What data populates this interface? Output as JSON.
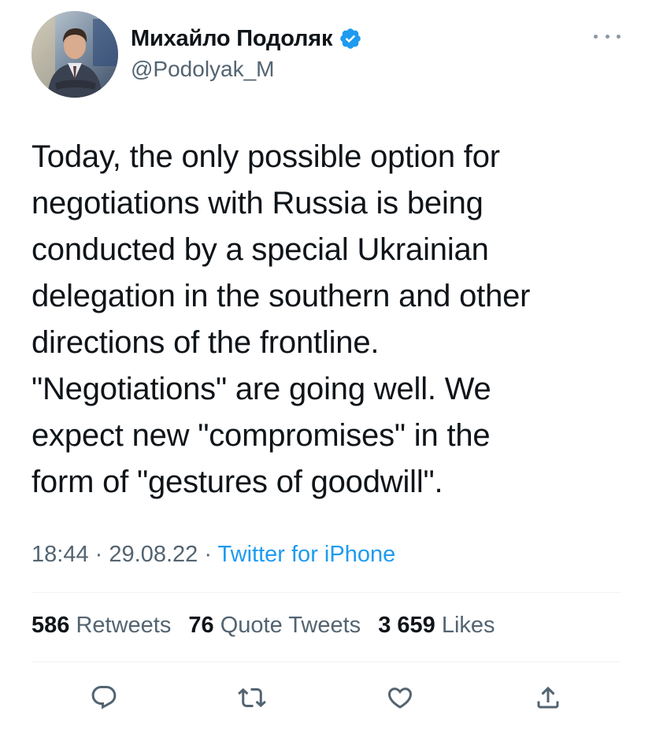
{
  "author": {
    "display_name": "Михайло Подоляк",
    "handle": "@Podolyak_M",
    "verified": true,
    "avatar_icon": "profile-photo"
  },
  "tweet": {
    "lines": [
      "Today, the only possible option for",
      "negotiations with Russia is being",
      "conducted by a special Ukrainian",
      "delegation in the southern and other",
      "directions of the frontline.",
      "\"Negotiations\" are going well. We",
      "expect new \"compromises\" in the",
      "form of \"gestures of goodwill\"."
    ]
  },
  "meta": {
    "time": "18:44",
    "separator": "·",
    "date": "29.08.22",
    "source": "Twitter for iPhone"
  },
  "stats": {
    "retweets_count": "586",
    "retweets_label": "Retweets",
    "quotes_count": "76",
    "quotes_label": "Quote Tweets",
    "likes_count": "3 659",
    "likes_label": "Likes"
  },
  "actions": {
    "reply_icon": "reply-icon",
    "retweet_icon": "retweet-icon",
    "like_icon": "heart-icon",
    "share_icon": "share-icon"
  },
  "colors": {
    "accent": "#1d9bf0",
    "text": "#0f1419",
    "secondary": "#536471",
    "divider": "#eff3f4"
  }
}
